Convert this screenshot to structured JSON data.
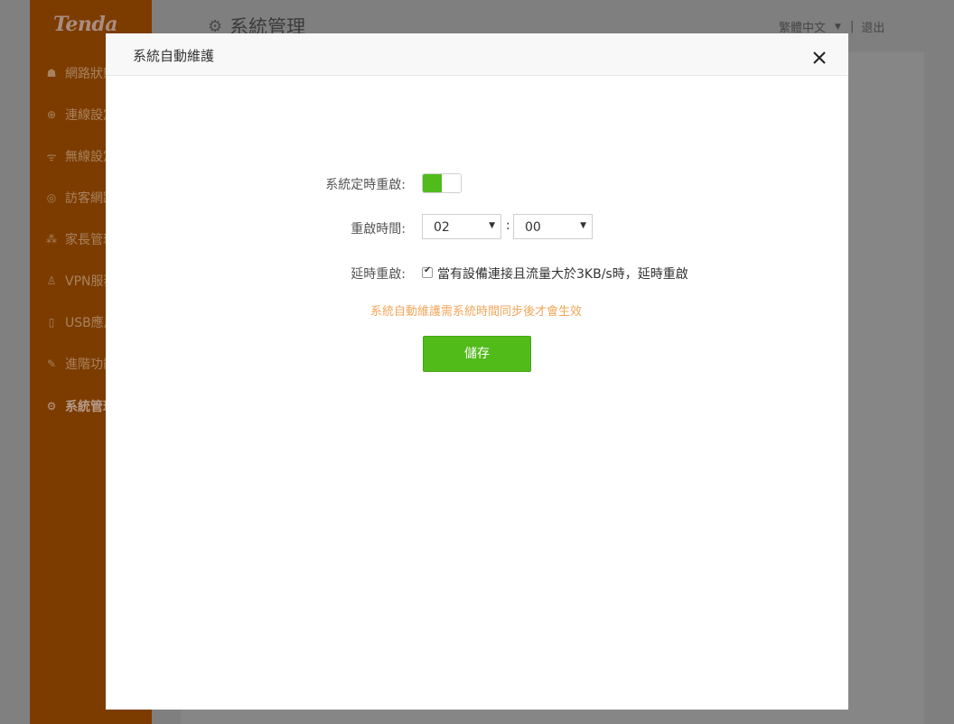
{
  "sidebar": {
    "logo": "Tenda",
    "items": [
      {
        "label": "網路狀態",
        "icon": "network-status-icon",
        "glyph": "☗"
      },
      {
        "label": "連線設定",
        "icon": "globe-icon",
        "glyph": "⊕"
      },
      {
        "label": "無線設定",
        "icon": "wifi-icon",
        "glyph": "ᯤ"
      },
      {
        "label": "訪客網路",
        "icon": "guest-icon",
        "glyph": "◎"
      },
      {
        "label": "家長管理",
        "icon": "parental-icon",
        "glyph": "⁂"
      },
      {
        "label": "VPN服務",
        "icon": "vpn-icon",
        "glyph": "♙"
      },
      {
        "label": "USB應用",
        "icon": "usb-icon",
        "glyph": "▯"
      },
      {
        "label": "進階功能",
        "icon": "wrench-icon",
        "glyph": "✎"
      },
      {
        "label": "系統管理",
        "icon": "gear-icon",
        "glyph": "⚙"
      }
    ]
  },
  "header": {
    "title": "系統管理",
    "language": "繁體中文",
    "separator": "|",
    "logout": "退出"
  },
  "modal": {
    "title": "系統自動維護",
    "fields": {
      "scheduled_reboot_label": "系統定時重啟:",
      "scheduled_reboot_enabled": true,
      "reboot_time_label": "重啟時間:",
      "hour": "02",
      "time_separator": ":",
      "minute": "00",
      "delay_reboot_label": "延時重啟:",
      "delay_reboot_checked": true,
      "delay_reboot_text": "當有設備連接且流量大於3KB/s時，延時重啟"
    },
    "notice": "系統自動維護需系統時間同步後才會生效",
    "save_label": "儲存"
  },
  "colors": {
    "accent_green": "#51bb1a",
    "notice_orange": "#f2a65a",
    "sidebar_brand": "#7c3c00"
  }
}
